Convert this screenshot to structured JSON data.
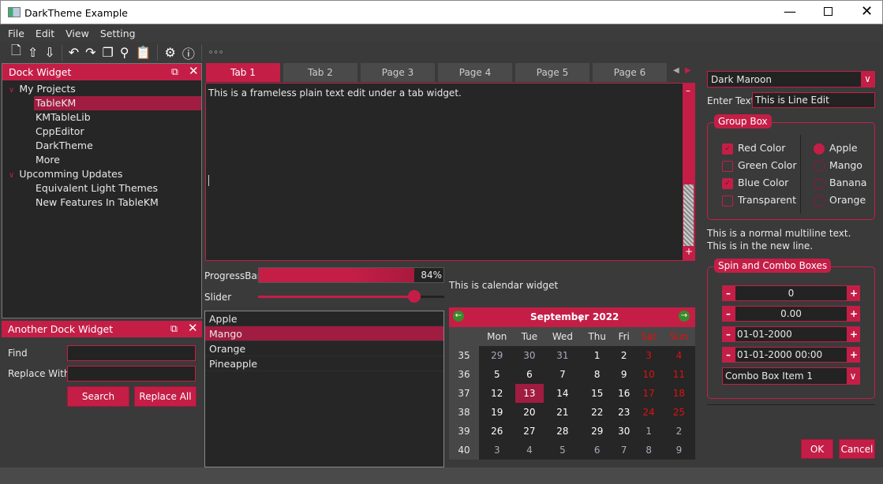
{
  "window": {
    "title": "DarkTheme Example"
  },
  "menu": [
    "File",
    "Edit",
    "View",
    "Setting"
  ],
  "toolbar": [
    "new-file",
    "export",
    "import",
    "undo",
    "redo",
    "copy",
    "search",
    "paste",
    "settings",
    "info",
    "more"
  ],
  "colors": {
    "accent": "#c41e47",
    "background": "#3a3a3a",
    "field": "#232323",
    "weekend": "#e01010"
  },
  "dock1": {
    "title": "Dock Widget",
    "tree": [
      {
        "label": "My Projects",
        "level": 0,
        "expanded": true
      },
      {
        "label": "TableKM",
        "level": 1,
        "selected": true
      },
      {
        "label": "KMTableLib",
        "level": 1
      },
      {
        "label": "CppEditor",
        "level": 1
      },
      {
        "label": "DarkTheme",
        "level": 1
      },
      {
        "label": "More",
        "level": 1
      },
      {
        "label": "Upcomming Updates",
        "level": 0,
        "expanded": true
      },
      {
        "label": "Equivalent Light Themes",
        "level": 1
      },
      {
        "label": "New Features In TableKM",
        "level": 1
      }
    ]
  },
  "dock2": {
    "title": "Another Dock Widget",
    "find_label": "Find",
    "replace_label": "Replace With",
    "find_value": "",
    "replace_value": "",
    "search_btn": "Search",
    "replace_all_btn": "Replace All"
  },
  "tabs": {
    "items": [
      "Tab 1",
      "Tab 2",
      "Page 3",
      "Page 4",
      "Page 5",
      "Page 6"
    ],
    "active": 0,
    "text": "This is a frameless plain text edit under a tab widget."
  },
  "progress": {
    "label": "ProgressBar",
    "value": 84,
    "text": "84%"
  },
  "slider": {
    "label": "Slider",
    "value": 0.84
  },
  "list": {
    "items": [
      "Apple",
      "Mango",
      "Orange",
      "Pineapple"
    ],
    "selected": 1
  },
  "calendar": {
    "caption": "This is  calendar widget",
    "month": "September",
    "year": "2022",
    "days": [
      "Mon",
      "Tue",
      "Wed",
      "Thu",
      "Fri",
      "Sat",
      "Sun"
    ],
    "weeks": [
      35,
      36,
      37,
      38,
      39,
      40
    ],
    "rows": [
      [
        "29",
        "30",
        "31",
        "1",
        "2",
        "3",
        "4"
      ],
      [
        "5",
        "6",
        "7",
        "8",
        "9",
        "10",
        "11"
      ],
      [
        "12",
        "13",
        "14",
        "15",
        "16",
        "17",
        "18"
      ],
      [
        "19",
        "20",
        "21",
        "22",
        "23",
        "24",
        "25"
      ],
      [
        "26",
        "27",
        "28",
        "29",
        "30",
        "1",
        "2"
      ],
      [
        "3",
        "4",
        "5",
        "6",
        "7",
        "8",
        "9"
      ]
    ],
    "selected": "13"
  },
  "right": {
    "combo": "Dark Maroon",
    "enter_label": "Enter Text",
    "line_edit": "This is Line Edit",
    "group_title": "Group Box",
    "checks": [
      {
        "label": "Red Color",
        "checked": true
      },
      {
        "label": "Green Color",
        "checked": false
      },
      {
        "label": "Blue Color",
        "checked": true
      },
      {
        "label": "Transparent",
        "checked": false
      }
    ],
    "radios": [
      {
        "label": "Apple",
        "checked": true
      },
      {
        "label": "Mango",
        "checked": false
      },
      {
        "label": "Banana",
        "checked": false
      },
      {
        "label": "Orange",
        "checked": false
      }
    ],
    "multiline1": "This is a normal multiline text.",
    "multiline2": "This is in the new line.",
    "spin_title": "Spin and Combo Boxes",
    "spin_int": "0",
    "spin_double": "0.00",
    "date": "01-01-2000",
    "datetime": "01-01-2000 00:00",
    "combo2": "Combo Box Item 1",
    "ok": "OK",
    "cancel": "Cancel"
  }
}
